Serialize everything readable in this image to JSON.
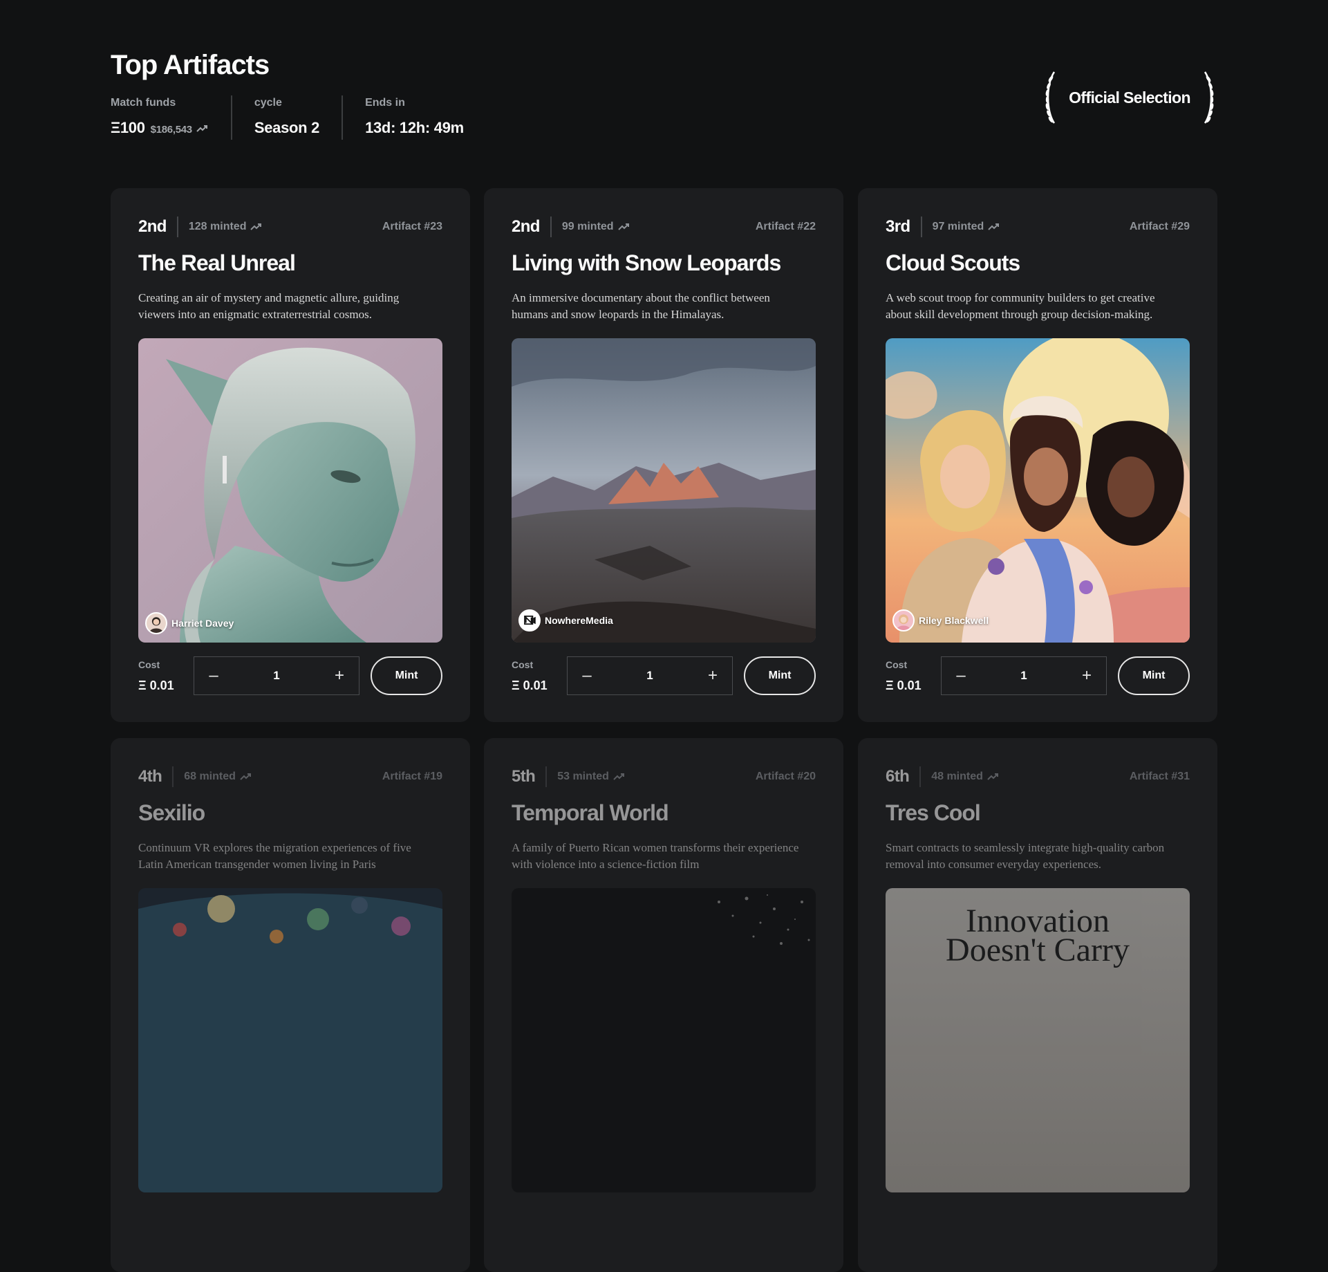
{
  "header": {
    "title": "Top Artifacts",
    "stats": [
      {
        "label": "Match funds",
        "value": "Ξ100",
        "sub": "$186,543",
        "trend": true
      },
      {
        "label": "cycle",
        "value": "Season 2"
      },
      {
        "label": "Ends in",
        "value": "13d: 12h: 49m"
      }
    ],
    "badge": "Official Selection"
  },
  "cards": [
    {
      "rank": "2nd",
      "minted": "128 minted",
      "artifact": "Artifact #23",
      "title": "The Real Unreal",
      "description": "Creating an air of mystery and magnetic allure, guiding viewers into an enigmatic extraterrestrial cosmos.",
      "creator": "Harriet Davey",
      "cost_label": "Cost",
      "cost": "Ξ 0.01",
      "quantity": "1",
      "mint_label": "Mint"
    },
    {
      "rank": "2nd",
      "minted": "99 minted",
      "artifact": "Artifact #22",
      "title": "Living with Snow Leopards",
      "description": "An immersive documentary about the conflict between humans and snow leopards in the Himalayas.",
      "creator": "NowhereMedia",
      "cost_label": "Cost",
      "cost": "Ξ 0.01",
      "quantity": "1",
      "mint_label": "Mint"
    },
    {
      "rank": "3rd",
      "minted": "97 minted",
      "artifact": "Artifact #29",
      "title": "Cloud Scouts",
      "description": "A web scout troop for community builders to get creative about skill development through group decision-making.",
      "creator": "Riley Blackwell",
      "cost_label": "Cost",
      "cost": "Ξ 0.01",
      "quantity": "1",
      "mint_label": "Mint"
    },
    {
      "rank": "4th",
      "minted": "68 minted",
      "artifact": "Artifact #19",
      "title": "Sexilio",
      "description": "Continuum VR explores the migration experiences of five Latin American transgender women living in Paris"
    },
    {
      "rank": "5th",
      "minted": "53 minted",
      "artifact": "Artifact #20",
      "title": "Temporal World",
      "description": "A family of Puerto Rican women transforms their experience with violence into a science-fiction film"
    },
    {
      "rank": "6th",
      "minted": "48 minted",
      "artifact": "Artifact #31",
      "title": "Tres Cool",
      "description": "Smart contracts to seamlessly integrate high-quality carbon removal into consumer everyday experiences.",
      "art_text": [
        "Innovation",
        "Doesn't Carry"
      ]
    }
  ]
}
